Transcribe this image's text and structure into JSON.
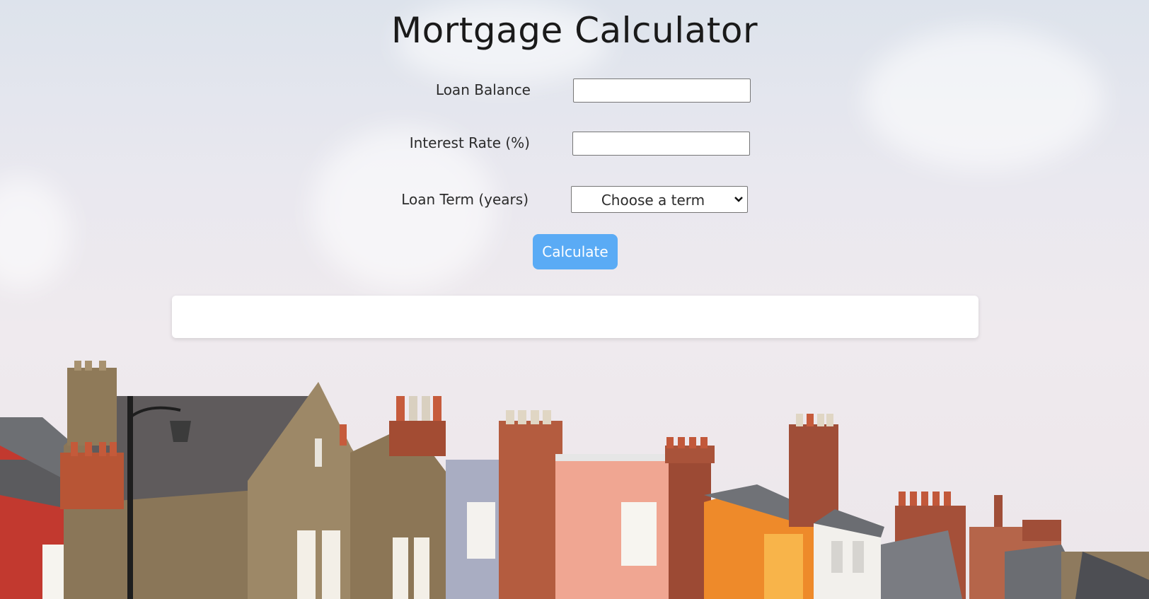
{
  "page": {
    "title": "Mortgage Calculator"
  },
  "form": {
    "loan_balance": {
      "label": "Loan Balance",
      "value": "",
      "placeholder": ""
    },
    "interest_rate": {
      "label": "Interest Rate (%)",
      "value": "",
      "placeholder": ""
    },
    "loan_term": {
      "label": "Loan Term (years)",
      "selected": "Choose a term"
    },
    "calculate_label": "Calculate"
  },
  "result": {
    "text": ""
  },
  "colors": {
    "accent": "#5aabf5",
    "title": "#1a1a1a",
    "result_bg": "#ffffff"
  },
  "icons": {
    "select_arrow": "chevron-down-icon"
  }
}
